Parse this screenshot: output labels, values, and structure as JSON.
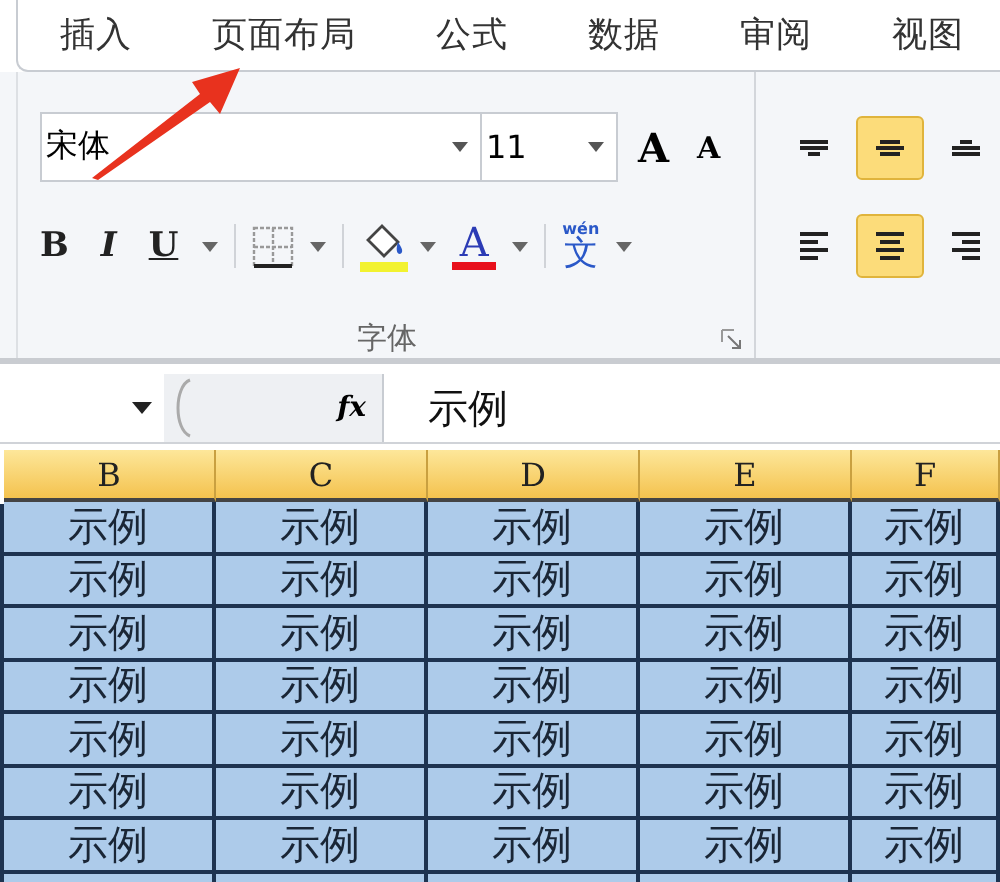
{
  "tabs": [
    {
      "label": "插入",
      "selected": false
    },
    {
      "label": "页面布局",
      "selected": false
    },
    {
      "label": "公式",
      "selected": false
    },
    {
      "label": "数据",
      "selected": false
    },
    {
      "label": "审阅",
      "selected": false
    },
    {
      "label": "视图",
      "selected": false
    }
  ],
  "font_group": {
    "font_name": "宋体",
    "font_size": "11",
    "grow_glyph": "A",
    "shrink_glyph": "A",
    "bold_glyph": "B",
    "italic_glyph": "I",
    "underline_glyph": "U",
    "font_color_glyph": "A",
    "phonetic_glyph": "文",
    "phonetic_ruby": "wén",
    "label": "字体"
  },
  "alignment": {
    "vertical": [
      {
        "kind": "top",
        "selected": false
      },
      {
        "kind": "middle",
        "selected": true
      },
      {
        "kind": "bottom",
        "selected": false
      }
    ],
    "horizontal": [
      {
        "kind": "left",
        "selected": false
      },
      {
        "kind": "center",
        "selected": true
      },
      {
        "kind": "right",
        "selected": false
      }
    ]
  },
  "formula_bar": {
    "fx": "fx",
    "value": "示例"
  },
  "sheet": {
    "columns": [
      {
        "label": "B",
        "selected": true
      },
      {
        "label": "C",
        "selected": true
      },
      {
        "label": "D",
        "selected": true
      },
      {
        "label": "E",
        "selected": true
      },
      {
        "label": "F",
        "selected": true
      }
    ],
    "rows": [
      {
        "selected": true,
        "cells": [
          "示例",
          "示例",
          "示例",
          "示例",
          "示例"
        ]
      },
      {
        "selected": true,
        "cells": [
          "示例",
          "示例",
          "示例",
          "示例",
          "示例"
        ]
      },
      {
        "selected": true,
        "cells": [
          "示例",
          "示例",
          "示例",
          "示例",
          "示例"
        ]
      },
      {
        "selected": true,
        "cells": [
          "示例",
          "示例",
          "示例",
          "示例",
          "示例"
        ]
      },
      {
        "selected": true,
        "cells": [
          "示例",
          "示例",
          "示例",
          "示例",
          "示例"
        ]
      },
      {
        "selected": true,
        "cells": [
          "示例",
          "示例",
          "示例",
          "示例",
          "示例"
        ]
      },
      {
        "selected": true,
        "cells": [
          "示例",
          "示例",
          "示例",
          "示例",
          "示例"
        ]
      }
    ]
  }
}
